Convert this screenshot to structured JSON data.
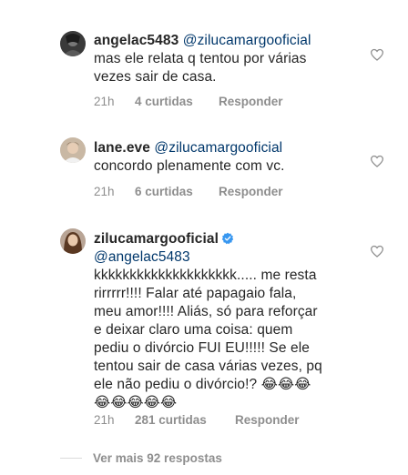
{
  "comments": [
    {
      "username": "angelac5483",
      "mention": "@zilucamargooficial",
      "lines": [
        "mas ele relata q tentou por várias",
        "vezes sair de casa."
      ],
      "time": "21h",
      "likes": "4 curtidas",
      "reply_label": "Responder",
      "avatar_icon": "user-avatar",
      "like_icon": "heart-outline-icon"
    },
    {
      "username": "lane.eve",
      "mention": "@zilucamargooficial",
      "lines": [
        "concordo plenamente com vc."
      ],
      "time": "21h",
      "likes": "6 curtidas",
      "reply_label": "Responder",
      "avatar_icon": "user-avatar",
      "like_icon": "heart-outline-icon"
    },
    {
      "username": "zilucamargooficial",
      "verified": true,
      "mention": "@angelac5483",
      "lines": [
        "kkkkkkkkkkkkkkkkkkkk..... me resta",
        "rirrrrr!!!! Falar até papagaio fala,",
        "meu amor!!!! Aliás, só para reforçar",
        "e deixar claro uma coisa: quem",
        "pediu o divórcio FUI EU!!!!! Se ele",
        "tentou sair de casa várias vezes, pq",
        "ele não pediu o divórcio!? 😂😂😂",
        "😂😂😂😂😂"
      ],
      "time": "21h",
      "likes": "281 curtidas",
      "reply_label": "Responder",
      "avatar_icon": "user-avatar",
      "like_icon": "heart-outline-icon",
      "badge_icon": "verified-badge-icon",
      "emoji_icon": "laughing-tears-emoji"
    }
  ],
  "more_replies": "Ver mais 92 respostas",
  "colors": {
    "text": "#262626",
    "secondary": "#8e8e8e",
    "mention": "#00376b",
    "verified": "#3897f0",
    "divider": "#dbdbdb"
  }
}
